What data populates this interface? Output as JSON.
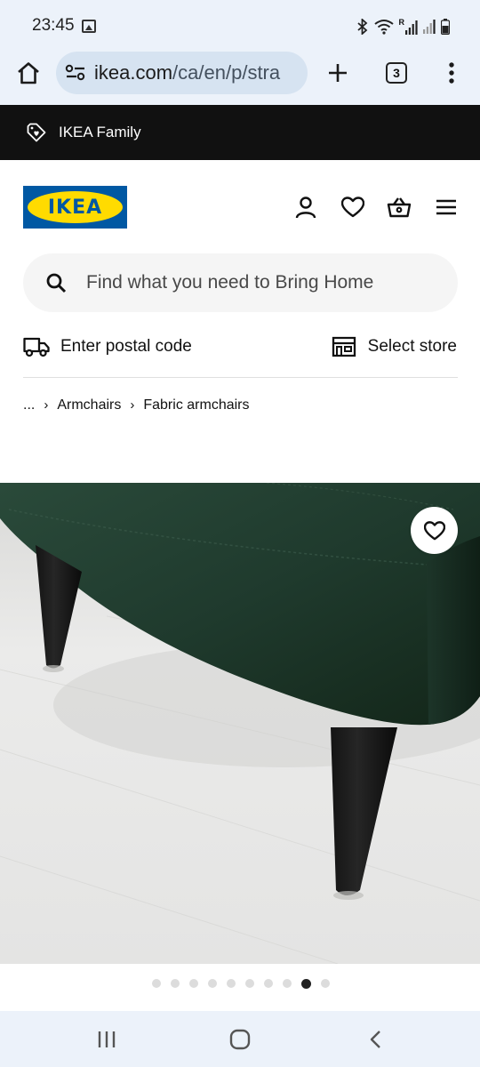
{
  "status_bar": {
    "time": "23:45",
    "icons": [
      "gallery-icon",
      "bluetooth-icon",
      "wifi-icon",
      "signal-icon",
      "signal-icon",
      "battery-icon"
    ],
    "signal_label": "R"
  },
  "browser": {
    "url_domain": "ikea.com",
    "url_path": "/ca/en/p/stra",
    "tab_count": "3",
    "icons": [
      "home-icon",
      "site-settings-icon",
      "plus-icon",
      "kebab-menu-icon"
    ]
  },
  "family_banner": {
    "label": "IKEA Family",
    "icon": "tag-icon"
  },
  "header": {
    "logo_text": "IKEA",
    "brand_colors": {
      "blue": "#0058a3",
      "yellow": "#ffdb00"
    },
    "icons": [
      "profile-icon",
      "heart-icon",
      "shopping-basket-icon",
      "hamburger-menu-icon"
    ]
  },
  "search": {
    "placeholder": "Find what you need to Bring Home"
  },
  "delivery": {
    "postal_label": "Enter postal code",
    "store_label": "Select store"
  },
  "breadcrumb": {
    "items": [
      "...",
      "Armchairs",
      "Fabric armchairs"
    ]
  },
  "product": {
    "image_description_icon": "green-velvet-armchair-photo",
    "chair_color": "#1c3329",
    "carousel": {
      "total": 10,
      "active_index": 8
    }
  },
  "nav_bar": {
    "icons": [
      "recents-icon",
      "home-circle-icon",
      "back-icon"
    ]
  }
}
